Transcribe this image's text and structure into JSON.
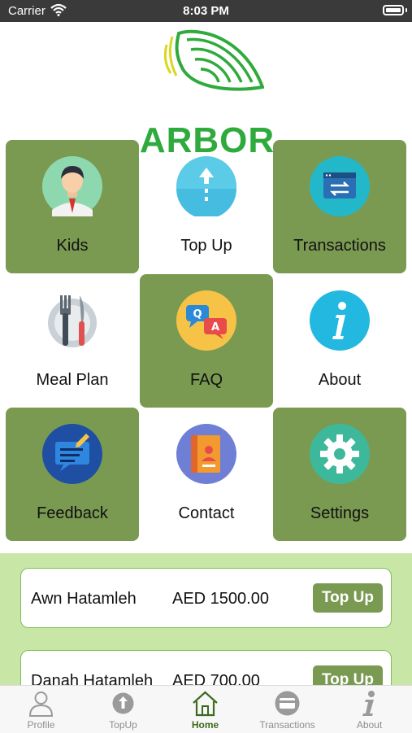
{
  "status_bar": {
    "carrier": "Carrier",
    "time": "8:03 PM"
  },
  "brand": {
    "name": "ARBOR",
    "color": "#2faa3c"
  },
  "menu": [
    {
      "label": "Kids",
      "icon": "kid-avatar-icon",
      "highlighted": true
    },
    {
      "label": "Top Up",
      "icon": "top-up-arrow-icon",
      "highlighted": false
    },
    {
      "label": "Transactions",
      "icon": "transactions-icon",
      "highlighted": true
    },
    {
      "label": "Meal Plan",
      "icon": "meal-plan-icon",
      "highlighted": false
    },
    {
      "label": "FAQ",
      "icon": "faq-chat-icon",
      "highlighted": true
    },
    {
      "label": "About",
      "icon": "info-icon",
      "highlighted": false
    },
    {
      "label": "Feedback",
      "icon": "feedback-icon",
      "highlighted": true
    },
    {
      "label": "Contact",
      "icon": "contact-book-icon",
      "highlighted": false
    },
    {
      "label": "Settings",
      "icon": "gear-icon",
      "highlighted": true
    }
  ],
  "balances": [
    {
      "name": "Awn Hatamleh",
      "amount": "AED 1500.00",
      "button": "Top Up"
    },
    {
      "name": "Danah Hatamleh",
      "amount": "AED 700.00",
      "button": "Top Up"
    }
  ],
  "tabs": [
    {
      "label": "Profile",
      "icon": "person-icon",
      "active": false
    },
    {
      "label": "TopUp",
      "icon": "top-up-icon",
      "active": false
    },
    {
      "label": "Home",
      "icon": "home-icon",
      "active": true
    },
    {
      "label": "Transactions",
      "icon": "card-icon",
      "active": false
    },
    {
      "label": "About",
      "icon": "info-icon",
      "active": false
    }
  ],
  "colors": {
    "tile_green": "#7a9a52",
    "panel_green": "#c8e6a6",
    "active_tab": "#3d6a1f"
  }
}
